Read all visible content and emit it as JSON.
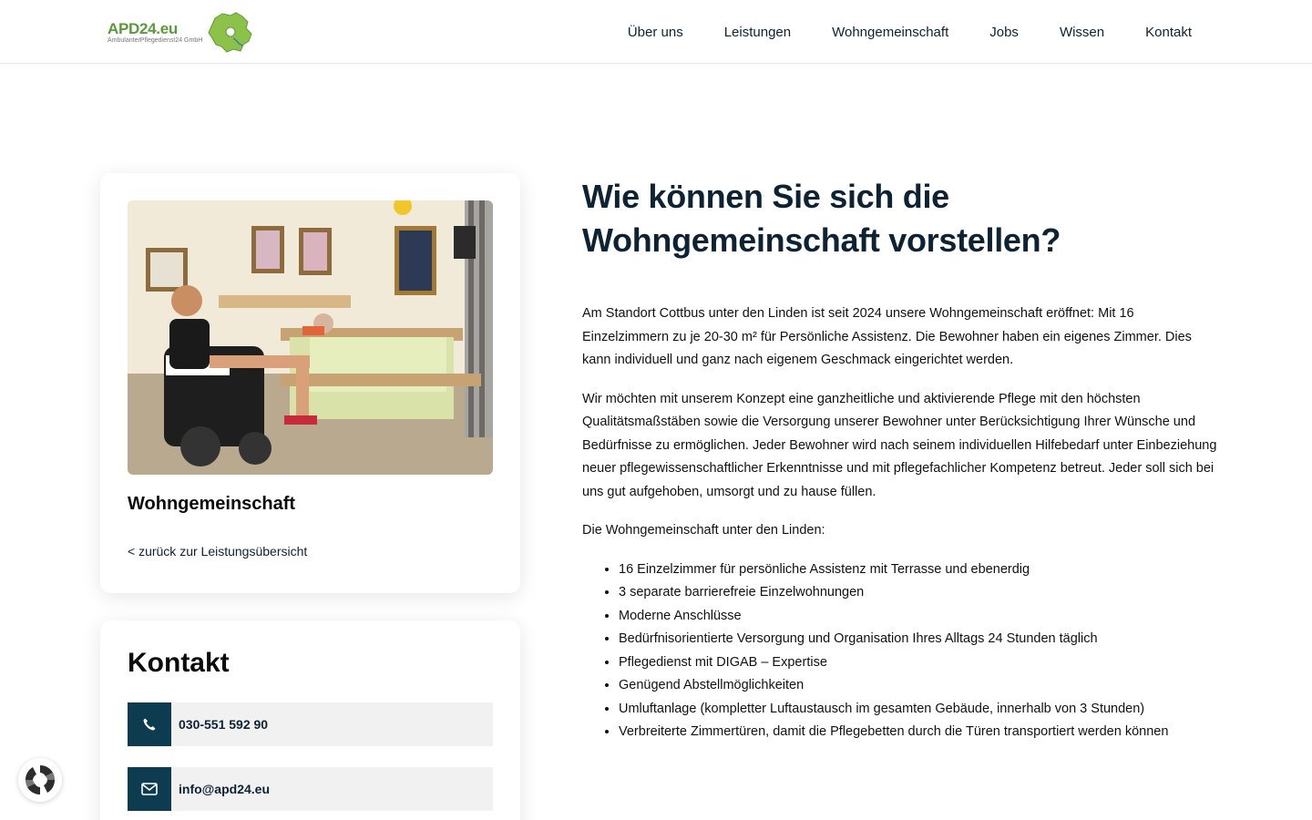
{
  "header": {
    "logo_text": "APD24.eu",
    "logo_subtext": "AmbulanterPflegedienst24 GmbH",
    "nav": [
      "Über uns",
      "Leistungen",
      "Wohngemeinschaft",
      "Jobs",
      "Wissen",
      "Kontakt"
    ]
  },
  "service_card": {
    "title": "Wohngemeinschaft",
    "back_link": "< zurück zur Leistungsübersicht"
  },
  "contact_card": {
    "title": "Kontakt",
    "phone": "030-551 592 90",
    "email": "info@apd24.eu"
  },
  "main": {
    "heading": "Wie können Sie sich die Wohngemeinschaft vorstellen?",
    "paragraphs": [
      "Am Standort Cottbus unter den Linden ist seit 2024 unsere Wohngemeinschaft eröffnet: Mit 16 Einzelzimmern zu je 20-30 m² für Persönliche Assistenz.  Die Bewohner haben ein eigenes Zimmer. Dies kann individuell und ganz nach eigenem Geschmack eingerichtet werden.",
      "Wir möchten mit unserem Konzept eine ganzheitliche und aktivierende Pflege mit den höchsten Qualitätsmaßstäben sowie die Versorgung unserer Bewohner unter Berücksichtigung Ihrer Wünsche und Bedürfnisse zu ermöglichen. Jeder Bewohner wird nach seinem individuellen Hilfebedarf unter Einbeziehung neuer pflegewissenschaftlicher Erkenntnisse und mit pflegefachlicher Kompetenz betreut. Jeder soll sich bei uns gut aufgehoben, umsorgt und zu hause füllen.",
      "Die Wohngemeinschaft unter den Linden:"
    ],
    "features": [
      "16 Einzelzimmer für persönliche Assistenz mit Terrasse und ebenerdig",
      "3 separate barrierefreie Einzelwohnungen",
      "Moderne Anschlüsse",
      "Bedürfnisorientierte Versorgung und Organisation Ihres Alltags 24 Stunden täglich",
      "Pflegedienst mit DIGAB – Expertise",
      "Genügend Abstellmöglichkeiten",
      "Umluftanlage (kompletter Luftaustausch im gesamten Gebäude, innerhalb von 3 Stunden)",
      "Verbreiterte Zimmertüren, damit die Pflegebetten durch die Türen transportiert werden können"
    ]
  },
  "colors": {
    "brand_green": "#5b9a3c",
    "dark_navy": "#0d2233",
    "icon_box": "#0d3b4f"
  },
  "icons": [
    "phone-icon",
    "mail-icon",
    "cookie-settings-icon",
    "brandenburg-map-icon"
  ]
}
